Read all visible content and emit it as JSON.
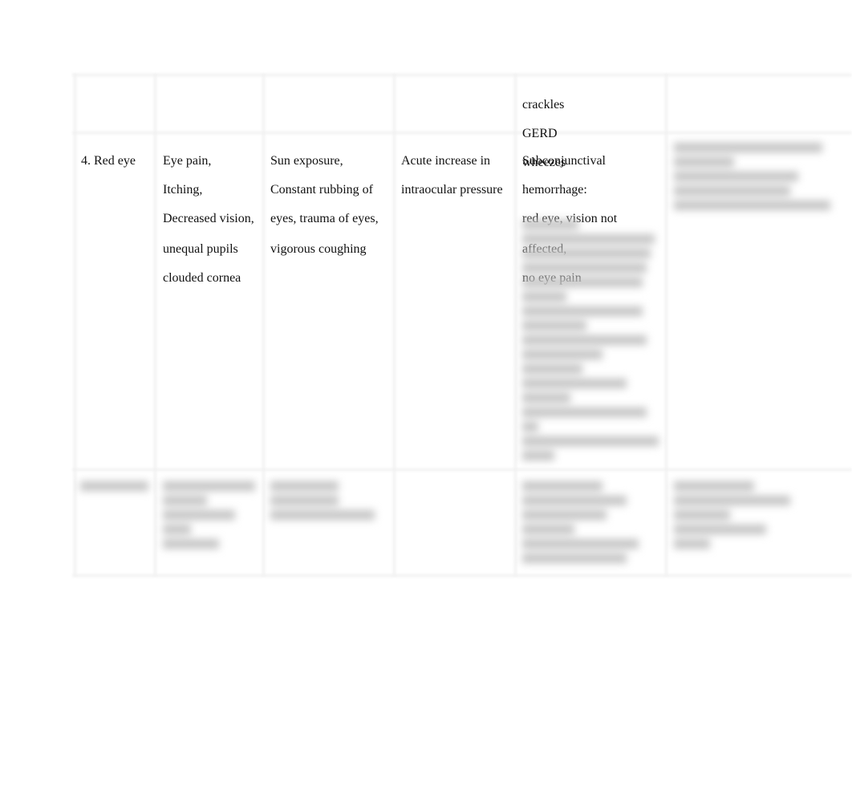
{
  "document": {
    "table": {
      "row_top_partial": {
        "col5_lines": [
          "crackles",
          "GERD",
          "wheezes"
        ]
      },
      "row_red_eye": {
        "condition": "4. Red eye",
        "symptoms": [
          "Eye pain,",
          "Itching,",
          "Decreased vision,",
          "unequal pupils",
          "clouded cornea"
        ],
        "causes": [
          "Sun exposure,",
          "Constant rubbing of",
          "eyes, trauma of eyes,",
          "vigorous coughing"
        ],
        "pathophysiology": [
          "Acute increase in",
          "intraocular pressure"
        ],
        "differential_visible": [
          "Subconjunctival",
          "hemorrhage:",
          "red eye, vision not",
          "affected,",
          "no eye pain"
        ],
        "differential_obscured": true,
        "col6_obscured": true
      },
      "row_next": {
        "obscured": true
      }
    }
  }
}
